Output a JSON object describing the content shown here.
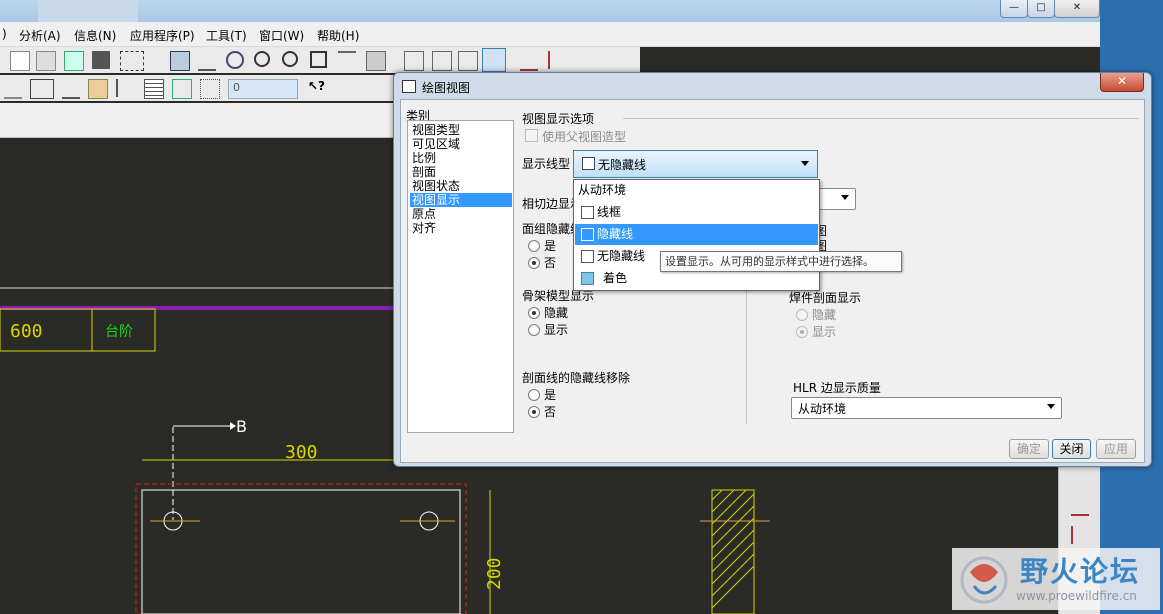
{
  "app": {
    "window_buttons": [
      "—",
      "□",
      "✕"
    ],
    "menu": [
      "分析(A)",
      "信息(N)",
      "应用程序(P)",
      "工具(T)",
      "窗口(W)",
      "帮助(H)"
    ],
    "menu_partial_left": ")",
    "toolbar_spinner_value": "0"
  },
  "drawing": {
    "dims": [
      "600",
      "300",
      "200"
    ],
    "section_label": "B",
    "cell_text": "台阶"
  },
  "dialog": {
    "title": "绘图视图",
    "close": "✕",
    "categories_label": "类别",
    "categories": [
      "视图类型",
      "可见区域",
      "比例",
      "剖面",
      "视图状态",
      "视图显示",
      "原点",
      "对齐"
    ],
    "selected_category": "视图显示",
    "options_group": "视图显示选项",
    "use_parent": "使用父视图造型",
    "line_style_label": "显示线型",
    "line_style_value": "无隐藏线",
    "dropdown_options": [
      "从动环境",
      "线框",
      "隐藏线",
      "无隐藏线",
      "着色"
    ],
    "dropdown_highlight": "隐藏线",
    "tooltip": "设置显示。从可用的显示样式中进行选择。",
    "tangent_label": "相切边显示",
    "face_hidden_label": "面组隐藏线",
    "yes": "是",
    "no": "否",
    "right_partial_a": "图",
    "right_partial_b": "图",
    "skeleton_label": "骨架模型显示",
    "hide": "隐藏",
    "show": "显示",
    "weld_label": "焊件剖面显示",
    "section_hidden_label": "剖面线的隐藏线移除",
    "hlr_label": "HLR 边显示质量",
    "hlr_value": "从动环境",
    "btn_ok": "确定",
    "btn_close": "关闭",
    "btn_apply": "应用"
  },
  "watermark": {
    "title": "野火论坛",
    "url": "www.proewildfire.cn"
  }
}
